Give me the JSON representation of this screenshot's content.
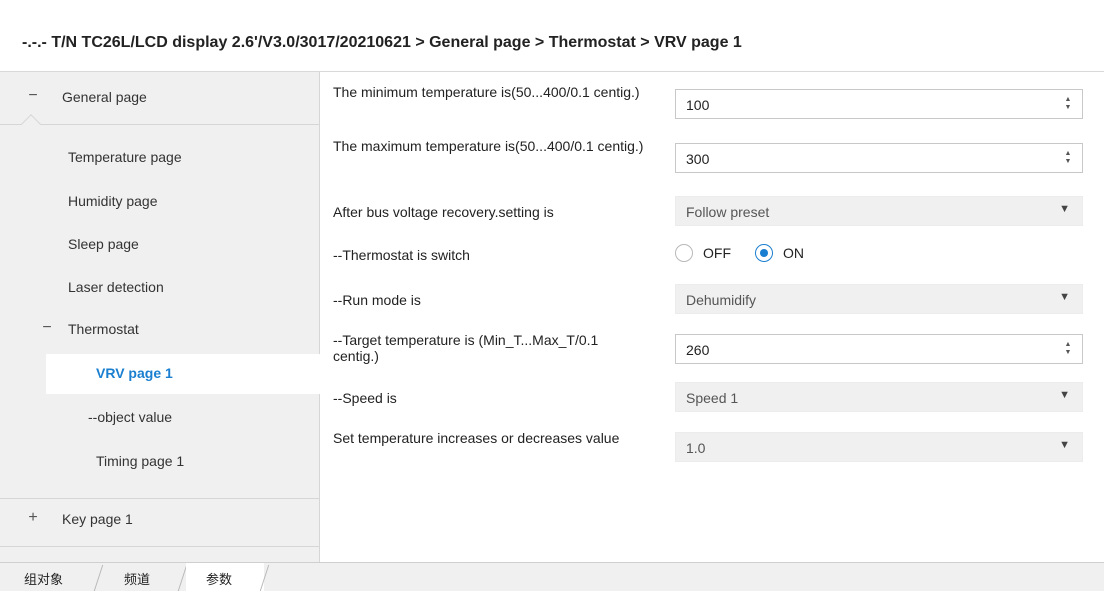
{
  "header": {
    "breadcrumb": "-.-.- T/N TC26L/LCD display 2.6'/V3.0/3017/20210621 > General page > Thermostat > VRV page 1"
  },
  "sidebar": {
    "general": {
      "expander": "−",
      "label": "General page"
    },
    "items": [
      {
        "label": "Temperature page"
      },
      {
        "label": "Humidity page"
      },
      {
        "label": "Sleep page"
      },
      {
        "label": "Laser detection"
      }
    ],
    "thermostat": {
      "expander": "−",
      "label": "Thermostat"
    },
    "sub_items": [
      {
        "label": "VRV page 1",
        "selected": true
      },
      {
        "label": "--object value"
      },
      {
        "label": "Timing page 1"
      }
    ],
    "key": {
      "expander": "+",
      "label": "Key page 1"
    }
  },
  "params": {
    "min_temp": {
      "label": "The minimum temperature is(50...400/0.1 centig.)",
      "value": "100"
    },
    "max_temp": {
      "label": "The maximum temperature is(50...400/0.1 centig.)",
      "value": "300"
    },
    "bus_recovery": {
      "label": "After bus voltage recovery.setting is",
      "value": "Follow preset"
    },
    "switch": {
      "label": "--Thermostat is switch",
      "off_label": "OFF",
      "on_label": "ON",
      "selected": "ON"
    },
    "run_mode": {
      "label": "--Run mode is",
      "value": "Dehumidify"
    },
    "target_temp": {
      "label": "--Target temperature is (Min_T...Max_T/0.1 centig.)",
      "value": "260"
    },
    "speed": {
      "label": "--Speed is",
      "value": "Speed 1"
    },
    "step": {
      "label": "Set temperature increases or decreases value",
      "value": "1.0"
    }
  },
  "tabs": [
    {
      "label": "组对象"
    },
    {
      "label": "频道"
    },
    {
      "label": "参数",
      "active": true
    }
  ],
  "colors": {
    "accent": "#1a7fd0",
    "sidebar_bg": "#f0f0f0"
  }
}
